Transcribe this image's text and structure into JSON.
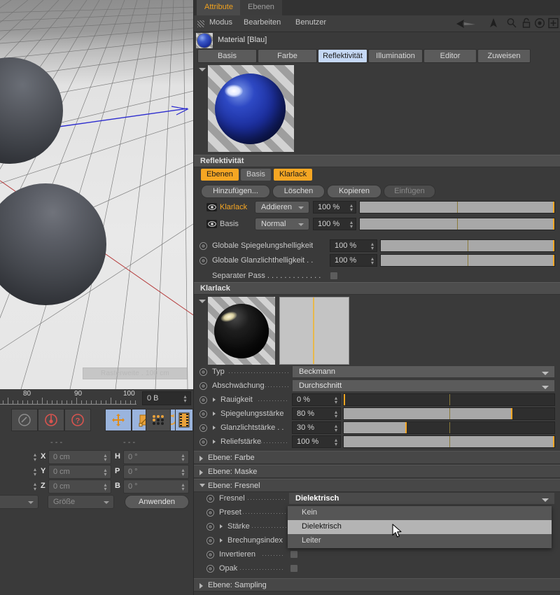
{
  "app": {
    "viewport": {
      "grid_label": "Rasterweite . 100 cm"
    },
    "timeline": {
      "ticks": [
        "80",
        "90",
        "100"
      ],
      "frame_value": "0 B"
    },
    "tools": [
      {
        "name": "undo-icon",
        "label": "undo"
      },
      {
        "name": "record-icon",
        "label": "record"
      },
      {
        "name": "help-record-icon",
        "label": "autokey"
      },
      {
        "name": "move-icon",
        "label": "move"
      },
      {
        "name": "scale-icon",
        "label": "scale"
      },
      {
        "name": "rotate-icon",
        "label": "rotate"
      },
      {
        "name": "parametric-icon",
        "label": "parametric"
      },
      {
        "name": "points-icon",
        "label": "points"
      },
      {
        "name": "render-icon",
        "label": "render"
      }
    ],
    "coords": {
      "dash_left": "- - -",
      "dash_right": "- - -",
      "rows": [
        {
          "axis": "X",
          "value": "0 cm",
          "axis2": "H",
          "value2": "0 °"
        },
        {
          "axis": "Y",
          "value": "0 cm",
          "axis2": "P",
          "value2": "0 °"
        },
        {
          "axis": "Z",
          "value": "0 cm",
          "axis2": "B",
          "value2": "0 °"
        }
      ],
      "mode_left": "",
      "mode_right": "Größe",
      "apply_label": "Anwenden"
    }
  },
  "attribute_manager": {
    "tabs": [
      {
        "label": "Attribute",
        "selected": true
      },
      {
        "label": "Ebenen",
        "selected": false
      }
    ],
    "menu": [
      "Modus",
      "Bearbeiten",
      "Benutzer"
    ],
    "header_icons": [
      "back-arrow-icon",
      "up-arrow-icon",
      "search-icon",
      "lock-icon",
      "target-icon",
      "plus-icon"
    ],
    "object_title": "Material [Blau]",
    "material_tabs": [
      {
        "label": "Basis",
        "active": false
      },
      {
        "label": "Farbe",
        "active": false
      },
      {
        "label": "Reflektivität",
        "active": true
      },
      {
        "label": "Illumination",
        "active": false
      },
      {
        "label": "Editor",
        "active": false
      },
      {
        "label": "Zuweisen",
        "active": false
      }
    ],
    "reflectivity": {
      "section_title": "Reflektivität",
      "mode_tabs": [
        {
          "label": "Ebenen",
          "on": true
        },
        {
          "label": "Basis",
          "on": false
        },
        {
          "label": "Klarlack",
          "on": true
        }
      ],
      "buttons": [
        {
          "label": "Hinzufügen...",
          "disabled": false
        },
        {
          "label": "Löschen",
          "disabled": false
        },
        {
          "label": "Kopieren",
          "disabled": false
        },
        {
          "label": "Einfügen",
          "disabled": true
        }
      ],
      "layers": [
        {
          "name": "Klarlack",
          "highlight": true,
          "blend": "Addieren",
          "amount": "100 %",
          "amount_pct": 100
        },
        {
          "name": "Basis",
          "highlight": false,
          "blend": "Normal",
          "amount": "100 %",
          "amount_pct": 100
        }
      ],
      "globals": [
        {
          "label": "Globale Spiegelungshelligkeit",
          "value": "100 %",
          "pct": 100
        },
        {
          "label": "Globale Glanzlichthelligkeit . .",
          "value": "100 %",
          "pct": 100
        }
      ],
      "separate_pass": {
        "label": "Separater Pass . . . . . . . . . . . . .",
        "checked": false
      }
    },
    "klarlack": {
      "section_title": "Klarlack",
      "type": {
        "label": "Typ",
        "value": "Beckmann"
      },
      "falloff": {
        "label": "Abschwächung",
        "value": "Durchschnitt"
      },
      "params": [
        {
          "label": "Rauigkeit",
          "value": "0 %",
          "pct": 0
        },
        {
          "label": "Spiegelungsstärke",
          "value": "80 %",
          "pct": 80
        },
        {
          "label": "Glanzlichtstärke . .",
          "value": "30 %",
          "pct": 30
        },
        {
          "label": "Reliefstärke",
          "value": "100 %",
          "pct": 100
        }
      ]
    },
    "groups": [
      {
        "label": "Ebene: Farbe",
        "open": false
      },
      {
        "label": "Ebene: Maske",
        "open": false
      },
      {
        "label": "Ebene: Fresnel",
        "open": true
      }
    ],
    "fresnel": {
      "rows": [
        {
          "label": "Fresnel",
          "dots": true,
          "value": "Dielektrisch",
          "kind": "select"
        },
        {
          "label": "Preset",
          "dots": true,
          "value": "",
          "kind": "select"
        },
        {
          "label": "Stärke",
          "dots": true,
          "value": "",
          "kind": "slider",
          "sub": true
        },
        {
          "label": "Brechungsindex",
          "dots": false,
          "value": "",
          "kind": "slider",
          "sub": true
        },
        {
          "label": "Invertieren",
          "dots": true,
          "value": "",
          "kind": "check"
        },
        {
          "label": "Opak",
          "dots": true,
          "value": "",
          "kind": "check"
        }
      ]
    },
    "dropdown": {
      "open": true,
      "options": [
        {
          "label": "Kein",
          "highlighted": false
        },
        {
          "label": "Dielektrisch",
          "highlighted": true
        },
        {
          "label": "Leiter",
          "highlighted": false
        }
      ]
    },
    "sampling_group": {
      "label": "Ebene: Sampling",
      "open": false
    }
  },
  "colors": {
    "accent_orange": "#f5a623",
    "tab_active_blue": "#c5d8f5",
    "panel_bg": "#3a3a3a",
    "field_bg": "#2e2e2e"
  }
}
